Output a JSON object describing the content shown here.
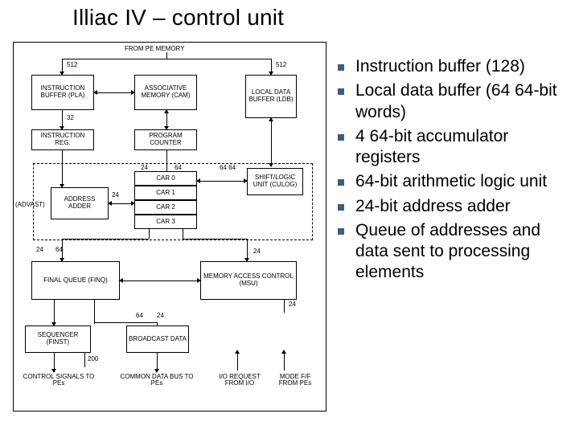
{
  "title": "Illiac IV – control unit",
  "bullets": [
    "Instruction buffer (128)",
    "Local data buffer (64 64-bit words)",
    "4 64-bit accumulator registers",
    "64-bit arithmetic logic unit",
    "24-bit address adder",
    "Queue of addresses and data sent to processing elements"
  ],
  "diagram": {
    "from_pe": "FROM PE MEMORY",
    "ibuf": "INSTRUCTION\nBUFFER\n(PLA)",
    "amem": "ASSOCIATIVE\nMEMORY\n(CAM)",
    "ldb": "LOCAL\nDATA\nBUFFER\n(LDB)",
    "ireg": "INSTRUCTION\nREG.",
    "pc": "PROGRAM\nCOUNTER",
    "slu": "SHIFT/LOGIC\nUNIT\n(CULOG)",
    "car0": "CAR 0",
    "car1": "CAR 1",
    "car2": "CAR 2",
    "car3": "CAR 3",
    "advast": "(ADVAST)",
    "addr_adder": "ADDRESS\nADDER",
    "finq": "FINAL QUEUE\n(FINQ)",
    "mac": "MEMORY ACCESS\nCONTROL\n(MSU)",
    "seq": "SEQUENCER\n(FINST)",
    "bcast": "BROADCAST\nDATA",
    "ctrl_sig": "CONTROL SIGNALS\nTO PEs",
    "cdb": "COMMON DATA BUS\nTO PEs",
    "ioreq": "I/O REQUEST\nFROM I/O",
    "mode": "MODE F/F\nFROM PEs",
    "w512a": "512",
    "w512b": "512",
    "w32": "32",
    "w24": "24",
    "w64": "64",
    "w64_64": "64  64",
    "w200": "200"
  }
}
